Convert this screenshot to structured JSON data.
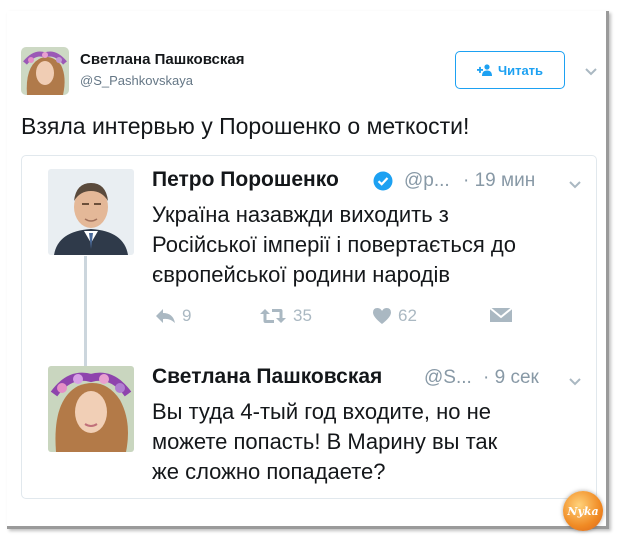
{
  "tweet": {
    "author_name": "Светлана Пашковская",
    "author_handle": "@S_Pashkovskaya",
    "follow_label": "Читать",
    "text": "Взяла интервью у Порошенко о меткости!"
  },
  "quoted_thread": [
    {
      "name": "Петро Порошенко",
      "handle": "@p...",
      "time": "· 19 мин",
      "text": "Україна назавжди виходить з\nРосійської імперії і повертається до\nєвропейської родини народів",
      "reply_count": "9",
      "retweet_count": "35",
      "like_count": "62"
    },
    {
      "name": "Светлана Пашковская",
      "handle": "@S...",
      "time": "· 9 сек",
      "text": "Вы туда 4-тый год входите, но не\nможете попасть! В Марину вы так\nже сложно попадаете?"
    }
  ],
  "watermark": "Nyka",
  "colors": {
    "accent": "#1da1f2",
    "muted": "#8899a6",
    "action": "#aab8c2",
    "text": "#14171a"
  }
}
